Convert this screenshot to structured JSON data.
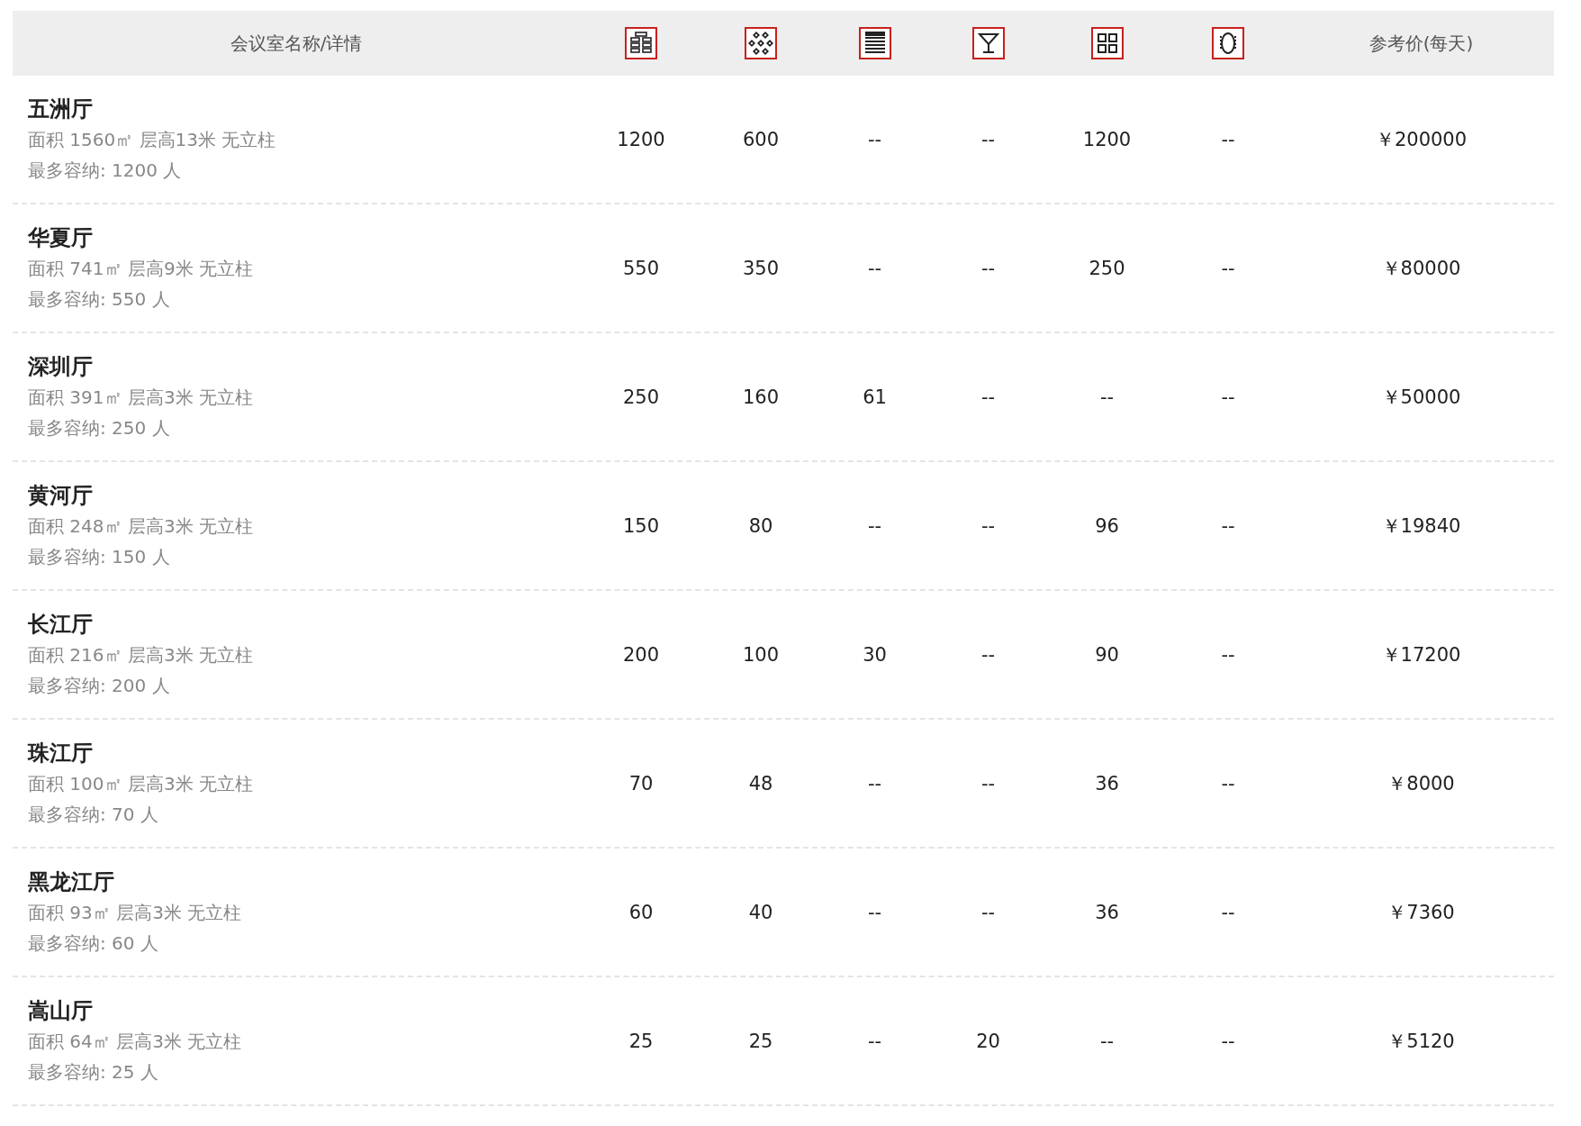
{
  "table": {
    "columns": {
      "name": "会议室名称/详情",
      "price": "参考价(每天)"
    },
    "rows": [
      {
        "name": "五洲厅",
        "details": "面积 1560㎡ 层高13米 无立柱",
        "capacity": "最多容纳: 1200 人",
        "values": [
          "1200",
          "600",
          "--",
          "--",
          "1200",
          "--"
        ],
        "price": "￥200000"
      },
      {
        "name": "华夏厅",
        "details": "面积 741㎡ 层高9米 无立柱",
        "capacity": "最多容纳: 550 人",
        "values": [
          "550",
          "350",
          "--",
          "--",
          "250",
          "--"
        ],
        "price": "￥80000"
      },
      {
        "name": "深圳厅",
        "details": "面积 391㎡ 层高3米 无立柱",
        "capacity": "最多容纳: 250 人",
        "values": [
          "250",
          "160",
          "61",
          "--",
          "--",
          "--"
        ],
        "price": "￥50000"
      },
      {
        "name": "黄河厅",
        "details": "面积 248㎡ 层高3米 无立柱",
        "capacity": "最多容纳: 150 人",
        "values": [
          "150",
          "80",
          "--",
          "--",
          "96",
          "--"
        ],
        "price": "￥19840"
      },
      {
        "name": "长江厅",
        "details": "面积 216㎡ 层高3米 无立柱",
        "capacity": "最多容纳: 200 人",
        "values": [
          "200",
          "100",
          "30",
          "--",
          "90",
          "--"
        ],
        "price": "￥17200"
      },
      {
        "name": "珠江厅",
        "details": "面积 100㎡ 层高3米 无立柱",
        "capacity": "最多容纳: 70 人",
        "values": [
          "70",
          "48",
          "--",
          "--",
          "36",
          "--"
        ],
        "price": "￥8000"
      },
      {
        "name": "黑龙江厅",
        "details": "面积 93㎡ 层高3米 无立柱",
        "capacity": "最多容纳: 60 人",
        "values": [
          "60",
          "40",
          "--",
          "--",
          "36",
          "--"
        ],
        "price": "￥7360"
      },
      {
        "name": "嵩山厅",
        "details": "面积 64㎡ 层高3米 无立柱",
        "capacity": "最多容纳: 25 人",
        "values": [
          "25",
          "25",
          "--",
          "20",
          "--",
          "--"
        ],
        "price": "￥5120"
      }
    ]
  }
}
